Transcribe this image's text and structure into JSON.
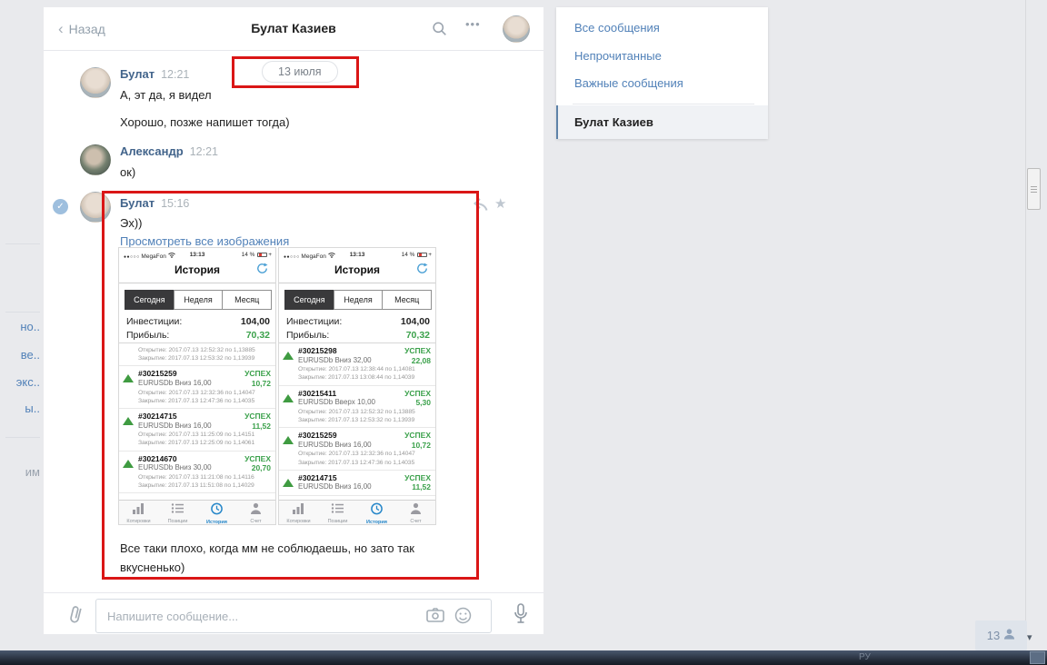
{
  "window": {
    "taskbar_hint": "РУ"
  },
  "left_sidebar": {
    "items": [
      "но..",
      "ве..",
      "экс..",
      "ы..",
      "им"
    ]
  },
  "chat": {
    "back_label": "Назад",
    "title": "Булат Казиев",
    "date_separator": "13 июля",
    "msg1": {
      "author": "Булат",
      "time": "12:21",
      "text": "А, эт да, я видел",
      "text2": "Хорошо, позже напишет тогда)"
    },
    "msg2": {
      "author": "Александр",
      "time": "12:21",
      "text": "ок)"
    },
    "msg3": {
      "author": "Булат",
      "time": "15:16",
      "text": "Эх))",
      "link": "Просмотреть все изображения",
      "caption_line1": "Все таки плохо, когда мм не соблюдаешь, но зато так",
      "caption_line2": "вкусненько)"
    },
    "composer_placeholder": "Напишите сообщение...",
    "participants_count": "13"
  },
  "right_menu": {
    "items": [
      "Все сообщения",
      "Непрочитанные",
      "Важные сообщения"
    ],
    "active_item": "Булат Казиев"
  },
  "phone_common": {
    "signal_dots": "●●○○○",
    "carrier": "MegaFon",
    "status_time": "13:13",
    "battery": "14 %",
    "battery_plus": "+",
    "title": "История",
    "tabs": [
      "Сегодня",
      "Неделя",
      "Месяц"
    ],
    "active_tab": "Сегодня",
    "investments_label": "Инвестиции:",
    "investments_value": "104,00",
    "profit_label": "Прибыль:",
    "profit_value": "70,32",
    "nav": [
      {
        "label": "Котировки",
        "icon": "bar-chart-icon",
        "active": false
      },
      {
        "label": "Позиции",
        "icon": "list-icon",
        "active": false
      },
      {
        "label": "История",
        "icon": "clock-icon",
        "active": true
      },
      {
        "label": "Счет",
        "icon": "person-icon",
        "active": false
      }
    ]
  },
  "phones": [
    {
      "trades": [
        {
          "open": "Открытие: 2017.07.13 12:52:32 по 1,13885",
          "close": "Закрытие: 2017.07.13 12:53:32 по 1,13939"
        },
        {
          "id": "#30215259",
          "status": "УСПЕХ",
          "desc": "EURUSDb Вниз 16,00",
          "profit": "10,72",
          "open": "Открытие: 2017.07.13 12:32:36 по 1,14047",
          "close": "Закрытие: 2017.07.13 12:47:36 по 1,14035"
        },
        {
          "id": "#30214715",
          "status": "УСПЕХ",
          "desc": "EURUSDb Вниз 16,00",
          "profit": "11,52",
          "open": "Открытие: 2017.07.13 11:25:09 по 1,14151",
          "close": "Закрытие: 2017.07.13 12:25:09 по 1,14061"
        },
        {
          "id": "#30214670",
          "status": "УСПЕХ",
          "desc": "EURUSDb Вниз 30,00",
          "profit": "20,70",
          "open": "Открытие: 2017.07.13 11:21:08 по 1,14116",
          "close": "Закрытие: 2017.07.13 11:51:08 по 1,14029"
        }
      ]
    },
    {
      "trades": [
        {
          "id": "#30215298",
          "status": "УСПЕХ",
          "desc": "EURUSDb Вниз 32,00",
          "profit": "22,08",
          "open": "Открытие: 2017.07.13 12:38:44 по 1,14081",
          "close": "Закрытие: 2017.07.13 13:08:44 по 1,14039"
        },
        {
          "id": "#30215411",
          "status": "УСПЕХ",
          "desc": "EURUSDb Вверх 10,00",
          "profit": "5,30",
          "open": "Открытие: 2017.07.13 12:52:32 по 1,13885",
          "close": "Закрытие: 2017.07.13 12:53:32 по 1,13939"
        },
        {
          "id": "#30215259",
          "status": "УСПЕХ",
          "desc": "EURUSDb Вниз 16,00",
          "profit": "10,72",
          "open": "Открытие: 2017.07.13 12:32:36 по 1,14047",
          "close": "Закрытие: 2017.07.13 12:47:36 по 1,14035"
        },
        {
          "id": "#30214715",
          "status": "УСПЕХ",
          "desc": "EURUSDb Вниз 16,00",
          "profit": "11,52"
        }
      ]
    }
  ],
  "colors": {
    "annotation_red": "#da1616",
    "link_blue": "#5181b8",
    "success_green": "#3ba14b",
    "active_nav_blue": "#2787c9"
  }
}
